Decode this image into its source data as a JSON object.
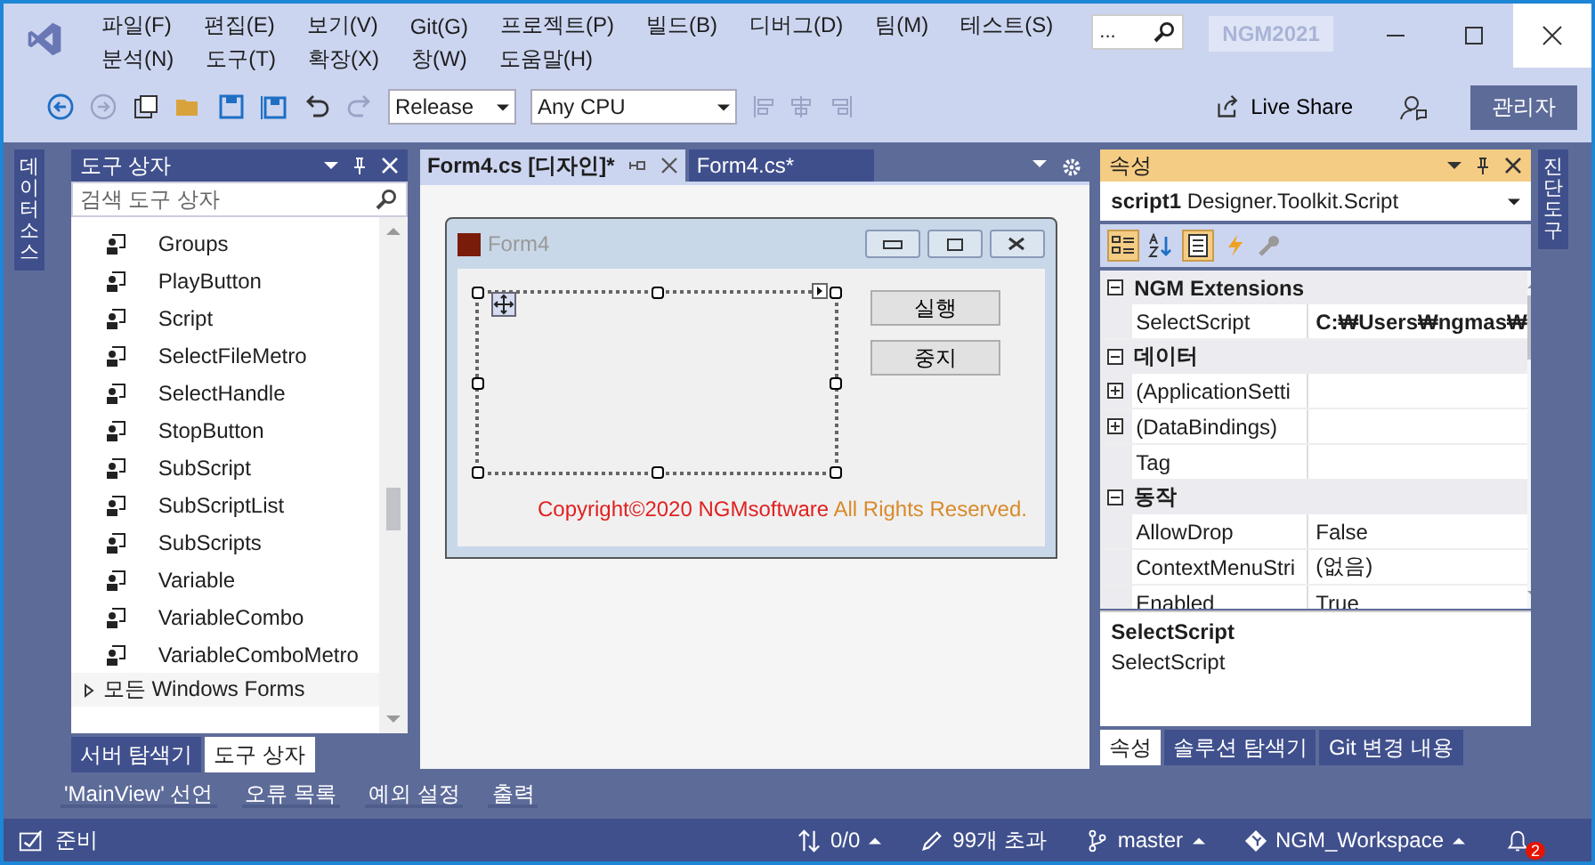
{
  "menu": [
    "파일(F)",
    "편집(E)",
    "보기(V)",
    "Git(G)",
    "프로젝트(P)",
    "빌드(B)",
    "디버그(D)",
    "팀(M)",
    "테스트(S)",
    "분석(N)",
    "도구(T)",
    "확장(X)",
    "창(W)",
    "도움말(H)"
  ],
  "search": {
    "placeholder": "..."
  },
  "title": "NGM2021",
  "toolbar": {
    "configuration": "Release",
    "platform": "Any CPU",
    "live_share": "Live Share",
    "admin": "관리자"
  },
  "left_strip": {
    "label": "데이터 소스"
  },
  "toolbox": {
    "title": "도구 상자",
    "search": {
      "placeholder": "검색 도구 상자"
    },
    "items": [
      "Groups",
      "PlayButton",
      "Script",
      "SelectFileMetro",
      "SelectHandle",
      "StopButton",
      "SubScript",
      "SubScriptList",
      "SubScripts",
      "Variable",
      "VariableCombo",
      "VariableComboMetro"
    ],
    "groups": [
      {
        "label": "모든 Windows Forms",
        "expanded": false
      }
    ],
    "tabs": [
      {
        "label": "서버 탐색기",
        "selected": false
      },
      {
        "label": "도구 상자",
        "selected": true
      }
    ]
  },
  "document": {
    "tabs": [
      {
        "label": "Form4.cs [디자인]*",
        "selected": true
      },
      {
        "label": "Form4.cs*",
        "selected": false
      }
    ],
    "form": {
      "title": "Form4",
      "buttons": [
        "실행",
        "중지"
      ],
      "copyright": "Copyright©2020 NGMsoftware",
      "rights": "All Rights Reserved."
    }
  },
  "properties": {
    "title": "속성",
    "object": "script1",
    "type": "Designer.Toolkit.Script",
    "categories": [
      {
        "name": "NGM Extensions",
        "expanded": true,
        "rows": [
          {
            "name": "SelectScript",
            "value": "C:₩Users₩ngmas₩",
            "expandable": false,
            "bold": true
          }
        ]
      },
      {
        "name": "데이터",
        "expanded": true,
        "rows": [
          {
            "name": "(ApplicationSetti",
            "expandable": true
          },
          {
            "name": "(DataBindings)",
            "expandable": true
          },
          {
            "name": "Tag",
            "expandable": false
          }
        ]
      },
      {
        "name": "동작",
        "expanded": true,
        "rows": [
          {
            "name": "AllowDrop",
            "value": "False",
            "expandable": false,
            "bold": false
          },
          {
            "name": "ContextMenuStri",
            "value": "(없음)",
            "expandable": false,
            "bold": false
          },
          {
            "name": "Enabled",
            "value": "True",
            "expandable": false,
            "bold": false
          }
        ]
      }
    ],
    "description": {
      "title": "SelectScript",
      "text": "SelectScript"
    },
    "tabs": [
      {
        "label": "속성",
        "selected": true
      },
      {
        "label": "솔루션 탐색기",
        "selected": false
      },
      {
        "label": "Git 변경 내용",
        "selected": false
      }
    ]
  },
  "right_strip": {
    "label": "진단 도구"
  },
  "bottom_tabs": [
    "'MainView' 선언",
    "오류 목록",
    "예외 설정",
    "출력"
  ],
  "status": {
    "ready": "준비",
    "changes": "0/0",
    "errors": "99개 초과",
    "branch": "master",
    "repo": "NGM_Workspace",
    "notifications": "2"
  }
}
